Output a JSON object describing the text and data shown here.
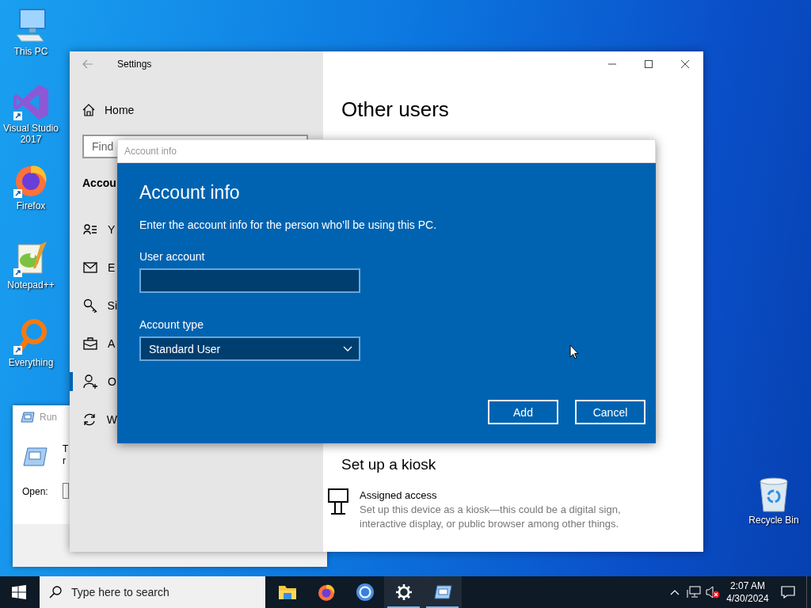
{
  "desktop_icons": [
    {
      "label": "This PC",
      "kind": "computer",
      "shortcut": false
    },
    {
      "label": "Visual Studio 2017",
      "kind": "visual-studio",
      "shortcut": true
    },
    {
      "label": "Firefox",
      "kind": "firefox",
      "shortcut": true
    },
    {
      "label": "Notepad++",
      "kind": "notepad",
      "shortcut": true
    },
    {
      "label": "Everything",
      "kind": "everything",
      "shortcut": true
    }
  ],
  "recycle_bin": {
    "label": "Recycle Bin"
  },
  "run_window": {
    "title": "Run",
    "text_lines": [
      "T",
      "r"
    ],
    "open_label": "Open:"
  },
  "settings": {
    "title": "Settings",
    "home": "Home",
    "search": {
      "placeholder": "Find"
    },
    "section": "Accou",
    "nav": [
      {
        "label": "Y",
        "kind": "info",
        "selected": false
      },
      {
        "label": "E",
        "kind": "mail",
        "selected": false
      },
      {
        "label": "Si",
        "kind": "key",
        "selected": false
      },
      {
        "label": "A",
        "kind": "work",
        "selected": false
      },
      {
        "label": "O",
        "kind": "users",
        "selected": true
      },
      {
        "label": "W",
        "kind": "sync",
        "selected": false
      }
    ],
    "page_title": "Other users",
    "kiosk": {
      "heading": "Set up a kiosk",
      "item_title": "Assigned access",
      "item_description": "Set up this device as a kiosk—this could be a digital sign, interactive display, or public browser among other things."
    }
  },
  "dialog": {
    "title": "Account info",
    "heading": "Account info",
    "description": "Enter the account info for the person who’ll be using this PC.",
    "fields": [
      {
        "label": "User account",
        "kind": "text"
      },
      {
        "label": "Account type",
        "kind": "select",
        "value": "Standard User"
      }
    ],
    "buttons": [
      "Add",
      "Cancel"
    ]
  },
  "taskbar": {
    "search": {
      "placeholder": "Type here to search"
    },
    "apps": [
      {
        "kind": "explorer",
        "active": false
      },
      {
        "kind": "firefox",
        "active": false
      },
      {
        "kind": "chromium",
        "active": false
      },
      {
        "kind": "settings",
        "active": true
      },
      {
        "kind": "run",
        "active": true
      }
    ],
    "volume_muted": true,
    "clock": {
      "time": "2:07 AM",
      "date": "4/30/2024"
    }
  }
}
